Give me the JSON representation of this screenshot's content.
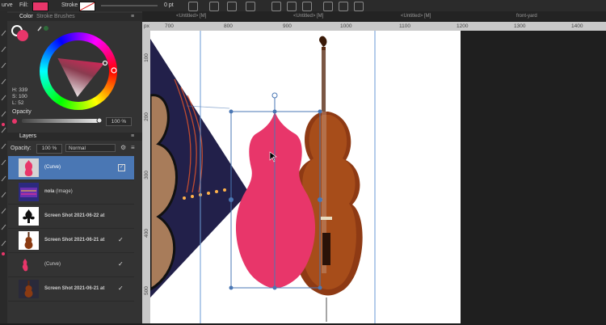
{
  "topbar": {
    "tool_label": "urve",
    "fill_label": "Fill:",
    "stroke_label": "Stroke",
    "stroke_width": "0 pt"
  },
  "panel": {
    "tabs": [
      "Color",
      "Stroke",
      "Brushes"
    ],
    "color": {
      "hex_fill": "#e8366a",
      "h": "H: 339",
      "s": "S: 100",
      "l": "L: 52",
      "opacity_label": "Opacity",
      "opacity_value": "100 %"
    },
    "layers": {
      "tab": "Layers",
      "opacity_label": "Opacity:",
      "opacity_value": "100 %",
      "blend_mode": "Normal",
      "items": [
        {
          "name": "(Curve)",
          "selected": true,
          "checked": true
        },
        {
          "name": "nola",
          "suffix": "(Image)",
          "checked": false
        },
        {
          "name": "Screen Shot 2021-06-22 at",
          "checked": false
        },
        {
          "name": "Screen Shot 2021-06-21 at",
          "checked": true
        },
        {
          "name": "(Curve)",
          "checked": true
        },
        {
          "name": "Screen Shot 2021-06-21 at",
          "checked": true
        }
      ]
    }
  },
  "doc_tabs": [
    "<Untitled> [M]",
    "<Untitled> [M]",
    "<Untitled> [M]",
    "front-yard"
  ],
  "ruler": {
    "top": [
      "700",
      "800",
      "900",
      "1000",
      "1100",
      "1200",
      "1300",
      "1400"
    ],
    "left": [
      "100",
      "200",
      "300",
      "400",
      "500"
    ],
    "unit": "px"
  },
  "colors": {
    "accent": "#e8366a",
    "selection": "#4a77b4"
  }
}
